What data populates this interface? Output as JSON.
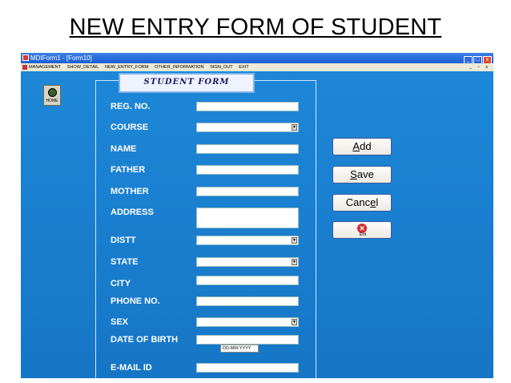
{
  "slide": {
    "title": "NEW ENTRY FORM OF STUDENT"
  },
  "window": {
    "title": "MDIForm1 - [Form10]",
    "controls": {
      "minimize": "_",
      "maximize": "□",
      "close": "x"
    }
  },
  "menu": {
    "items": [
      "MANAGEMENT",
      "SHOW_DETAIL",
      "NEW_ENTRY_FORM",
      "OTHER_INFORMATION",
      "SIGN_OUT",
      "EXIT"
    ],
    "child_controls": "_ ▫ x"
  },
  "home_button": {
    "label": "HOME",
    "icon": "house-icon"
  },
  "form": {
    "caption": "STUDENT FORM",
    "labels": {
      "reg_no": "REG. NO.",
      "course": "COURSE",
      "name": "NAME",
      "father": "FATHER",
      "mother": "MOTHER",
      "address": "ADDRESS",
      "distt": "DISTT",
      "state": "STATE",
      "city": "CITY",
      "phone_no": "PHONE NO.",
      "sex": "SEX",
      "date_of_birth": "DATE OF BIRTH",
      "email_id": "E-MAIL ID"
    },
    "dob_placeholder": "DD-MM-YYYY"
  },
  "buttons": {
    "add": {
      "accel": "A",
      "rest": "dd"
    },
    "save": {
      "accel": "S",
      "rest": "ave"
    },
    "cancel": {
      "pre": "Canc",
      "accel": "e",
      "rest": "l"
    },
    "exit": {
      "label": "Exit",
      "icon": "exit-icon"
    }
  },
  "colors": {
    "desktop": "#1a7fd0",
    "titlebar": "#1b5fd4",
    "menubar": "#ece9d8",
    "label": "#ffffff"
  }
}
